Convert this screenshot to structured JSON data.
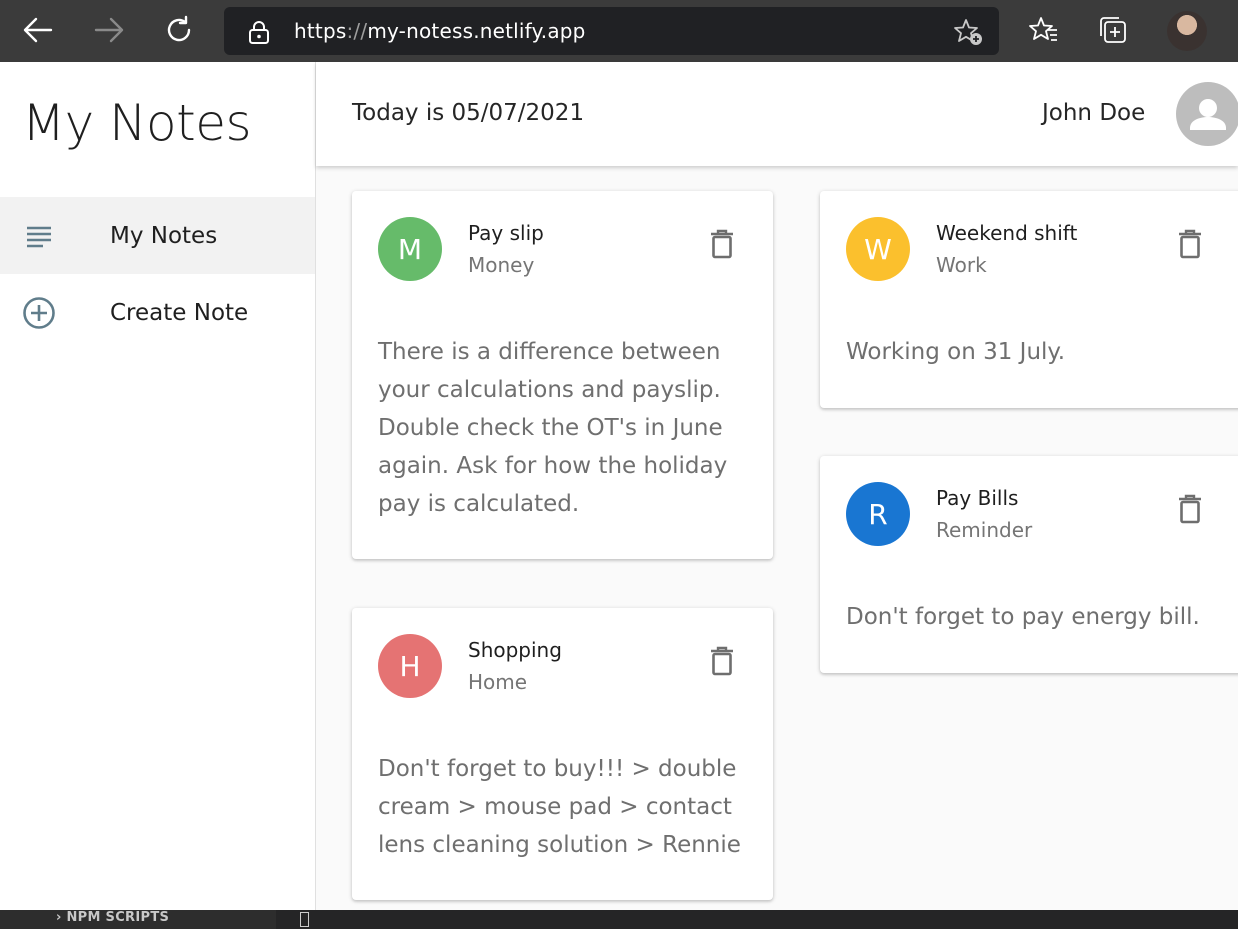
{
  "browser": {
    "url_scheme": "https",
    "url_sep": "://",
    "url_host": "my-notess.netlify.app"
  },
  "sidebar": {
    "title": "My Notes",
    "items": [
      {
        "label": "My Notes",
        "icon": "subject-icon",
        "active": true
      },
      {
        "label": "Create Note",
        "icon": "add-circle-outline-icon",
        "active": false
      }
    ]
  },
  "header": {
    "today": "Today is 05/07/2021",
    "user_name": "John Doe"
  },
  "notes": [
    {
      "initial": "M",
      "title": "Pay slip",
      "category": "Money",
      "color": "#66bb6a",
      "lines": [
        "There is a difference between",
        "your calculations and payslip.",
        "Double check the OT's in June",
        "again. Ask for how the holiday",
        "pay is calculated."
      ]
    },
    {
      "initial": "W",
      "title": "Weekend shift",
      "category": "Work",
      "color": "#fbc02d",
      "lines": [
        "Working on 31 July."
      ]
    },
    {
      "initial": "R",
      "title": "Pay Bills",
      "category": "Reminder",
      "color": "#1976d2",
      "lines": [
        "Don't forget to pay energy bill."
      ]
    },
    {
      "initial": "H",
      "title": "Shopping",
      "category": "Home",
      "color": "#e57373",
      "lines": [
        "Don't forget to buy!!! > double",
        "cream > mouse pad > contact",
        "lens cleaning solution > Rennie"
      ]
    }
  ],
  "status_strip": {
    "npm_label": "NPM SCRIPTS"
  }
}
